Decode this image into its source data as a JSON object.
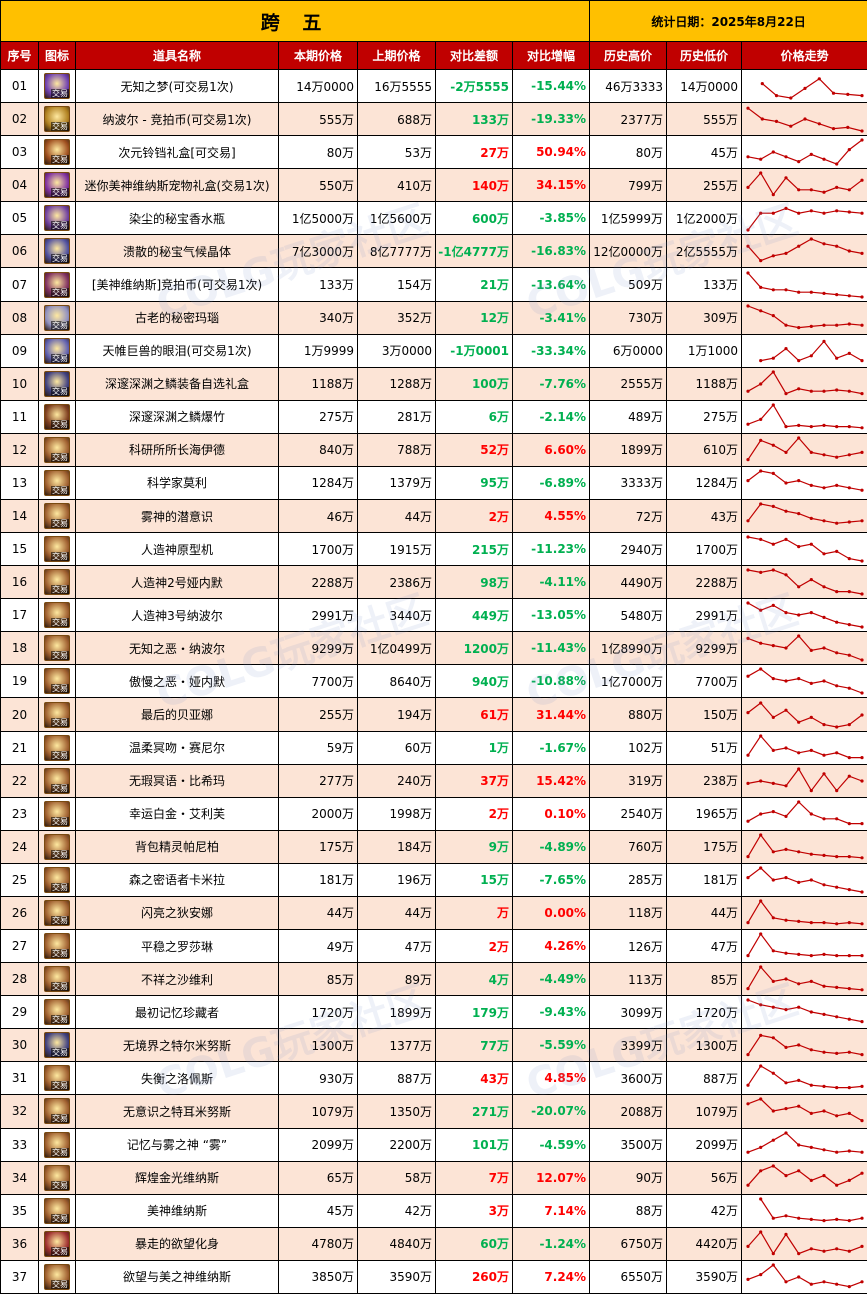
{
  "title": "跨 五",
  "date_label": "统计日期：2025年8月22日",
  "headers": [
    "序号",
    "图标",
    "道具名称",
    "本期价格",
    "上期价格",
    "对比差额",
    "对比增幅",
    "历史高价",
    "历史低价",
    "价格走势"
  ],
  "watermark": "COLG玩家社区",
  "colors": {
    "header_bg": "#c00000",
    "banner_bg": "#ffc000",
    "alt_row": "#fce4d6",
    "up": "#ff0000",
    "down": "#00b050",
    "trend_line": "#c00000"
  },
  "icon_tag": "交易",
  "rows": [
    {
      "id": "01",
      "name": "无知之梦(可交易1次)",
      "cur": "14万0000",
      "prev": "16万5555",
      "diff": "-2万5555",
      "pct": "-15.44%",
      "high": "46万3333",
      "low": "14万0000",
      "dir": "down",
      "icon_color": "#7040b0",
      "trend": [
        null,
        0.4,
        0.9,
        1.0,
        0.6,
        0.2,
        0.8,
        0.85,
        0.9
      ]
    },
    {
      "id": "02",
      "name": "纳波尔 - 竞拍币(可交易1次)",
      "cur": "555万",
      "prev": "688万",
      "diff": "133万",
      "pct": "-19.33%",
      "high": "2377万",
      "low": "555万",
      "dir": "down",
      "icon_color": "#b08020",
      "trend": [
        0.05,
        0.5,
        0.6,
        0.8,
        0.5,
        0.7,
        0.9,
        0.85,
        1.0
      ]
    },
    {
      "id": "03",
      "name": "次元铃铛礼盒[可交易]",
      "cur": "80万",
      "prev": "53万",
      "diff": "27万",
      "pct": "50.94%",
      "high": "80万",
      "low": "45万",
      "dir": "up",
      "icon_color": "#a05020",
      "trend": [
        0.7,
        0.8,
        0.5,
        0.7,
        0.9,
        0.6,
        0.8,
        1.0,
        0.4,
        0.0
      ]
    },
    {
      "id": "04",
      "name": "迷你美神维纳斯宠物礼盒(交易1次)",
      "cur": "550万",
      "prev": "410万",
      "diff": "140万",
      "pct": "34.15%",
      "high": "799万",
      "low": "255万",
      "dir": "up",
      "icon_color": "#8030a0",
      "trend": [
        0.6,
        0.0,
        0.9,
        0.2,
        0.7,
        0.7,
        0.8,
        0.6,
        0.7,
        0.3
      ]
    },
    {
      "id": "05",
      "name": "染尘的秘宝香水瓶",
      "cur": "1亿5000万",
      "prev": "1亿5600万",
      "diff": "600万",
      "pct": "-3.85%",
      "high": "1亿5999万",
      "low": "1亿2000万",
      "dir": "down",
      "icon_color": "#7040a0",
      "trend": [
        1.0,
        0.3,
        0.3,
        0.1,
        0.3,
        0.2,
        0.3,
        0.2,
        0.25,
        0.3
      ]
    },
    {
      "id": "06",
      "name": "溃散的秘宝气候晶体",
      "cur": "7亿3000万",
      "prev": "8亿7777万",
      "diff": "-1亿4777万",
      "pct": "-16.83%",
      "high": "12亿0000万",
      "low": "2亿5555万",
      "dir": "down",
      "icon_color": "#5050a0",
      "trend": [
        0.3,
        0.9,
        0.7,
        0.6,
        0.3,
        0.0,
        0.2,
        0.3,
        0.5,
        0.6
      ]
    },
    {
      "id": "07",
      "name": "[美神维纳斯]竞拍币(可交易1次)",
      "cur": "133万",
      "prev": "154万",
      "diff": "21万",
      "pct": "-13.64%",
      "high": "509万",
      "low": "133万",
      "dir": "down",
      "icon_color": "#803060",
      "trend": [
        0.0,
        0.6,
        0.7,
        0.7,
        0.8,
        0.8,
        0.85,
        0.9,
        0.95,
        1.0
      ]
    },
    {
      "id": "08",
      "name": "古老的秘密玛瑙",
      "cur": "340万",
      "prev": "352万",
      "diff": "12万",
      "pct": "-3.41%",
      "high": "730万",
      "low": "309万",
      "dir": "down",
      "icon_color": "#9090c0",
      "trend": [
        0.0,
        0.2,
        0.4,
        0.8,
        0.9,
        0.85,
        0.8,
        0.8,
        0.75,
        0.8
      ]
    },
    {
      "id": "09",
      "name": "天帷巨兽的眼泪(可交易1次)",
      "cur": "1万9999",
      "prev": "3万0000",
      "diff": "-1万0001",
      "pct": "-33.34%",
      "high": "6万0000",
      "low": "1万1000",
      "dir": "down",
      "icon_color": "#6060b0",
      "trend": [
        null,
        0.9,
        0.8,
        0.4,
        0.9,
        0.7,
        0.1,
        0.8,
        0.6,
        0.9
      ]
    },
    {
      "id": "10",
      "name": "深邃深渊之鳞装备自选礼盒",
      "cur": "1188万",
      "prev": "1288万",
      "diff": "100万",
      "pct": "-7.76%",
      "high": "2555万",
      "low": "1188万",
      "dir": "down",
      "icon_color": "#404080",
      "trend": [
        0.8,
        0.5,
        0.0,
        0.9,
        0.7,
        0.8,
        0.8,
        0.75,
        0.8,
        0.9
      ]
    },
    {
      "id": "11",
      "name": "深邃深渊之鳞爆竹",
      "cur": "275万",
      "prev": "281万",
      "diff": "6万",
      "pct": "-2.14%",
      "high": "489万",
      "low": "275万",
      "dir": "down",
      "icon_color": "#804020",
      "trend": [
        0.8,
        0.6,
        0.0,
        0.9,
        0.85,
        0.9,
        0.85,
        0.9,
        0.9,
        0.95
      ]
    },
    {
      "id": "12",
      "name": "科研所所长海伊德",
      "cur": "840万",
      "prev": "788万",
      "diff": "52万",
      "pct": "6.60%",
      "high": "1899万",
      "low": "610万",
      "dir": "up",
      "icon_color": "#a06030",
      "trend": [
        0.9,
        0.1,
        0.3,
        0.6,
        0.0,
        0.6,
        0.7,
        0.8,
        0.7,
        0.6
      ]
    },
    {
      "id": "13",
      "name": "科学家莫利",
      "cur": "1284万",
      "prev": "1379万",
      "diff": "95万",
      "pct": "-6.89%",
      "high": "3333万",
      "low": "1284万",
      "dir": "down",
      "icon_color": "#a06030",
      "trend": [
        0.4,
        0.0,
        0.1,
        0.5,
        0.4,
        0.6,
        0.7,
        0.6,
        0.7,
        0.8
      ]
    },
    {
      "id": "14",
      "name": "雾神的潜意识",
      "cur": "46万",
      "prev": "44万",
      "diff": "2万",
      "pct": "4.55%",
      "high": "72万",
      "low": "43万",
      "dir": "up",
      "icon_color": "#a06030",
      "trend": [
        0.7,
        0.0,
        0.1,
        0.3,
        0.4,
        0.6,
        0.7,
        0.8,
        0.75,
        0.7
      ]
    },
    {
      "id": "15",
      "name": "人造神原型机",
      "cur": "1700万",
      "prev": "1915万",
      "diff": "215万",
      "pct": "-11.23%",
      "high": "2940万",
      "low": "1700万",
      "dir": "down",
      "icon_color": "#a06030",
      "trend": [
        0.0,
        0.1,
        0.3,
        0.1,
        0.4,
        0.3,
        0.7,
        0.6,
        0.9,
        1.0
      ]
    },
    {
      "id": "16",
      "name": "人造神2号娅内默",
      "cur": "2288万",
      "prev": "2386万",
      "diff": "98万",
      "pct": "-4.11%",
      "high": "4490万",
      "low": "2288万",
      "dir": "down",
      "icon_color": "#a06030",
      "trend": [
        0.0,
        0.1,
        0.0,
        0.2,
        0.7,
        0.4,
        0.7,
        0.9,
        0.9,
        1.0
      ]
    },
    {
      "id": "17",
      "name": "人造神3号纳波尔",
      "cur": "2991万",
      "prev": "3440万",
      "diff": "449万",
      "pct": "-13.05%",
      "high": "5480万",
      "low": "2991万",
      "dir": "down",
      "icon_color": "#a06030",
      "trend": [
        0.0,
        0.3,
        0.1,
        0.4,
        0.5,
        0.4,
        0.6,
        0.8,
        0.9,
        1.0
      ]
    },
    {
      "id": "18",
      "name": "无知之恶・纳波尔",
      "cur": "9299万",
      "prev": "1亿0499万",
      "diff": "1200万",
      "pct": "-11.43%",
      "high": "1亿8990万",
      "low": "9299万",
      "dir": "down",
      "icon_color": "#a06030",
      "trend": [
        0.1,
        0.3,
        0.4,
        0.5,
        0.0,
        0.6,
        0.5,
        0.7,
        0.8,
        1.0
      ]
    },
    {
      "id": "19",
      "name": "傲慢之恶・娅内默",
      "cur": "7700万",
      "prev": "8640万",
      "diff": "940万",
      "pct": "-10.88%",
      "high": "1亿7000万",
      "low": "7700万",
      "dir": "down",
      "icon_color": "#a06030",
      "trend": [
        0.3,
        0.0,
        0.4,
        0.5,
        0.4,
        0.6,
        0.5,
        0.7,
        0.8,
        1.0
      ]
    },
    {
      "id": "20",
      "name": "最后的贝亚娜",
      "cur": "255万",
      "prev": "194万",
      "diff": "61万",
      "pct": "31.44%",
      "high": "880万",
      "low": "150万",
      "dir": "up",
      "icon_color": "#a06030",
      "trend": [
        0.4,
        0.0,
        0.6,
        0.3,
        0.8,
        0.6,
        0.9,
        1.0,
        0.9,
        0.5
      ]
    },
    {
      "id": "21",
      "name": "温柔冥吻・赛尼尔",
      "cur": "59万",
      "prev": "60万",
      "diff": "1万",
      "pct": "-1.67%",
      "high": "102万",
      "low": "51万",
      "dir": "down",
      "icon_color": "#a06030",
      "trend": [
        0.8,
        0.0,
        0.6,
        0.5,
        0.7,
        0.6,
        0.8,
        0.7,
        0.9,
        0.9
      ]
    },
    {
      "id": "22",
      "name": "无瑕冥语・比希玛",
      "cur": "277万",
      "prev": "240万",
      "diff": "37万",
      "pct": "15.42%",
      "high": "319万",
      "low": "238万",
      "dir": "up",
      "icon_color": "#a06030",
      "trend": [
        0.6,
        0.5,
        0.6,
        0.7,
        0.0,
        0.9,
        0.2,
        0.9,
        0.3,
        0.5
      ]
    },
    {
      "id": "23",
      "name": "幸运白金・艾利芙",
      "cur": "2000万",
      "prev": "1998万",
      "diff": "2万",
      "pct": "0.10%",
      "high": "2540万",
      "low": "1965万",
      "dir": "up",
      "icon_color": "#a06030",
      "trend": [
        0.8,
        0.5,
        0.4,
        0.6,
        0.0,
        0.5,
        0.7,
        0.7,
        0.9,
        0.9
      ]
    },
    {
      "id": "24",
      "name": "背包精灵帕尼柏",
      "cur": "175万",
      "prev": "184万",
      "diff": "9万",
      "pct": "-4.89%",
      "high": "760万",
      "low": "175万",
      "dir": "down",
      "icon_color": "#a06030",
      "trend": [
        0.9,
        0.0,
        0.7,
        0.6,
        0.7,
        0.8,
        0.85,
        0.9,
        0.9,
        0.95
      ]
    },
    {
      "id": "25",
      "name": "森之密语者卡米拉",
      "cur": "181万",
      "prev": "196万",
      "diff": "15万",
      "pct": "-7.65%",
      "high": "285万",
      "low": "181万",
      "dir": "down",
      "icon_color": "#a06030",
      "trend": [
        0.4,
        0.0,
        0.5,
        0.4,
        0.6,
        0.5,
        0.7,
        0.8,
        0.9,
        1.0
      ]
    },
    {
      "id": "26",
      "name": "闪亮之狄安娜",
      "cur": "44万",
      "prev": "44万",
      "diff": "万",
      "pct": "0.00%",
      "high": "118万",
      "low": "44万",
      "dir": "up",
      "icon_color": "#a06030",
      "trend": [
        0.9,
        0.0,
        0.7,
        0.8,
        0.85,
        0.9,
        0.9,
        0.95,
        0.9,
        0.95
      ]
    },
    {
      "id": "27",
      "name": "平稳之罗莎琳",
      "cur": "49万",
      "prev": "47万",
      "diff": "2万",
      "pct": "4.26%",
      "high": "126万",
      "low": "47万",
      "dir": "up",
      "icon_color": "#a06030",
      "trend": [
        0.9,
        0.0,
        0.7,
        0.8,
        0.85,
        0.9,
        0.85,
        0.9,
        0.9,
        0.9
      ]
    },
    {
      "id": "28",
      "name": "不祥之沙维利",
      "cur": "85万",
      "prev": "89万",
      "diff": "4万",
      "pct": "-4.49%",
      "high": "113万",
      "low": "85万",
      "dir": "down",
      "icon_color": "#a06030",
      "trend": [
        0.9,
        0.0,
        0.6,
        0.5,
        0.7,
        0.6,
        0.8,
        0.85,
        0.9,
        0.95
      ]
    },
    {
      "id": "29",
      "name": "最初记忆珍藏者",
      "cur": "1720万",
      "prev": "1899万",
      "diff": "179万",
      "pct": "-9.43%",
      "high": "3099万",
      "low": "1720万",
      "dir": "down",
      "icon_color": "#a06030",
      "trend": [
        0.0,
        0.2,
        0.3,
        0.4,
        0.3,
        0.5,
        0.6,
        0.7,
        0.8,
        0.9
      ]
    },
    {
      "id": "30",
      "name": "无境界之特尔米努斯",
      "cur": "1300万",
      "prev": "1377万",
      "diff": "77万",
      "pct": "-5.59%",
      "high": "3399万",
      "low": "1300万",
      "dir": "down",
      "icon_color": "#404080",
      "trend": [
        0.9,
        0.1,
        0.2,
        0.6,
        0.5,
        0.7,
        0.8,
        0.85,
        0.8,
        0.9
      ]
    },
    {
      "id": "31",
      "name": "失衡之洛佩斯",
      "cur": "930万",
      "prev": "887万",
      "diff": "43万",
      "pct": "4.85%",
      "high": "3600万",
      "low": "887万",
      "dir": "up",
      "icon_color": "#a06030",
      "trend": [
        0.8,
        0.0,
        0.3,
        0.7,
        0.6,
        0.8,
        0.85,
        0.9,
        0.9,
        0.85
      ]
    },
    {
      "id": "32",
      "name": "无意识之特耳米努斯",
      "cur": "1079万",
      "prev": "1350万",
      "diff": "271万",
      "pct": "-20.07%",
      "high": "2088万",
      "low": "1079万",
      "dir": "down",
      "icon_color": "#a06030",
      "trend": [
        0.2,
        0.0,
        0.5,
        0.4,
        0.3,
        0.6,
        0.5,
        0.7,
        0.6,
        0.9
      ]
    },
    {
      "id": "33",
      "name": "记忆与雾之神 “雾”",
      "cur": "2099万",
      "prev": "2200万",
      "diff": "101万",
      "pct": "-4.59%",
      "high": "3500万",
      "low": "2099万",
      "dir": "down",
      "icon_color": "#a06030",
      "trend": [
        0.8,
        0.6,
        0.3,
        0.0,
        0.5,
        0.6,
        0.7,
        0.8,
        0.75,
        0.8
      ]
    },
    {
      "id": "34",
      "name": "辉煌金光维纳斯",
      "cur": "65万",
      "prev": "58万",
      "diff": "7万",
      "pct": "12.07%",
      "high": "90万",
      "low": "56万",
      "dir": "up",
      "icon_color": "#a06030",
      "trend": [
        0.8,
        0.2,
        0.0,
        0.4,
        0.2,
        0.6,
        0.4,
        0.8,
        0.6,
        0.3
      ]
    },
    {
      "id": "35",
      "name": "美神维纳斯",
      "cur": "45万",
      "prev": "42万",
      "diff": "3万",
      "pct": "7.14%",
      "high": "88万",
      "low": "42万",
      "dir": "up",
      "icon_color": "#a06030",
      "trend": [
        null,
        0.0,
        0.8,
        0.7,
        0.8,
        0.85,
        0.9,
        0.85,
        0.9,
        0.8
      ]
    },
    {
      "id": "36",
      "name": "暴走的欲望化身",
      "cur": "4780万",
      "prev": "4840万",
      "diff": "60万",
      "pct": "-1.24%",
      "high": "6750万",
      "low": "4420万",
      "dir": "down",
      "icon_color": "#a03030",
      "trend": [
        0.6,
        0.0,
        0.9,
        0.1,
        0.9,
        0.7,
        0.8,
        0.7,
        0.8,
        0.6
      ]
    },
    {
      "id": "37",
      "name": "欲望与美之神维纳斯",
      "cur": "3850万",
      "prev": "3590万",
      "diff": "260万",
      "pct": "7.24%",
      "high": "6550万",
      "low": "3590万",
      "dir": "up",
      "icon_color": "#a06030",
      "trend": [
        0.6,
        0.4,
        0.0,
        0.7,
        0.5,
        0.8,
        0.7,
        0.8,
        0.9,
        0.7
      ]
    }
  ]
}
